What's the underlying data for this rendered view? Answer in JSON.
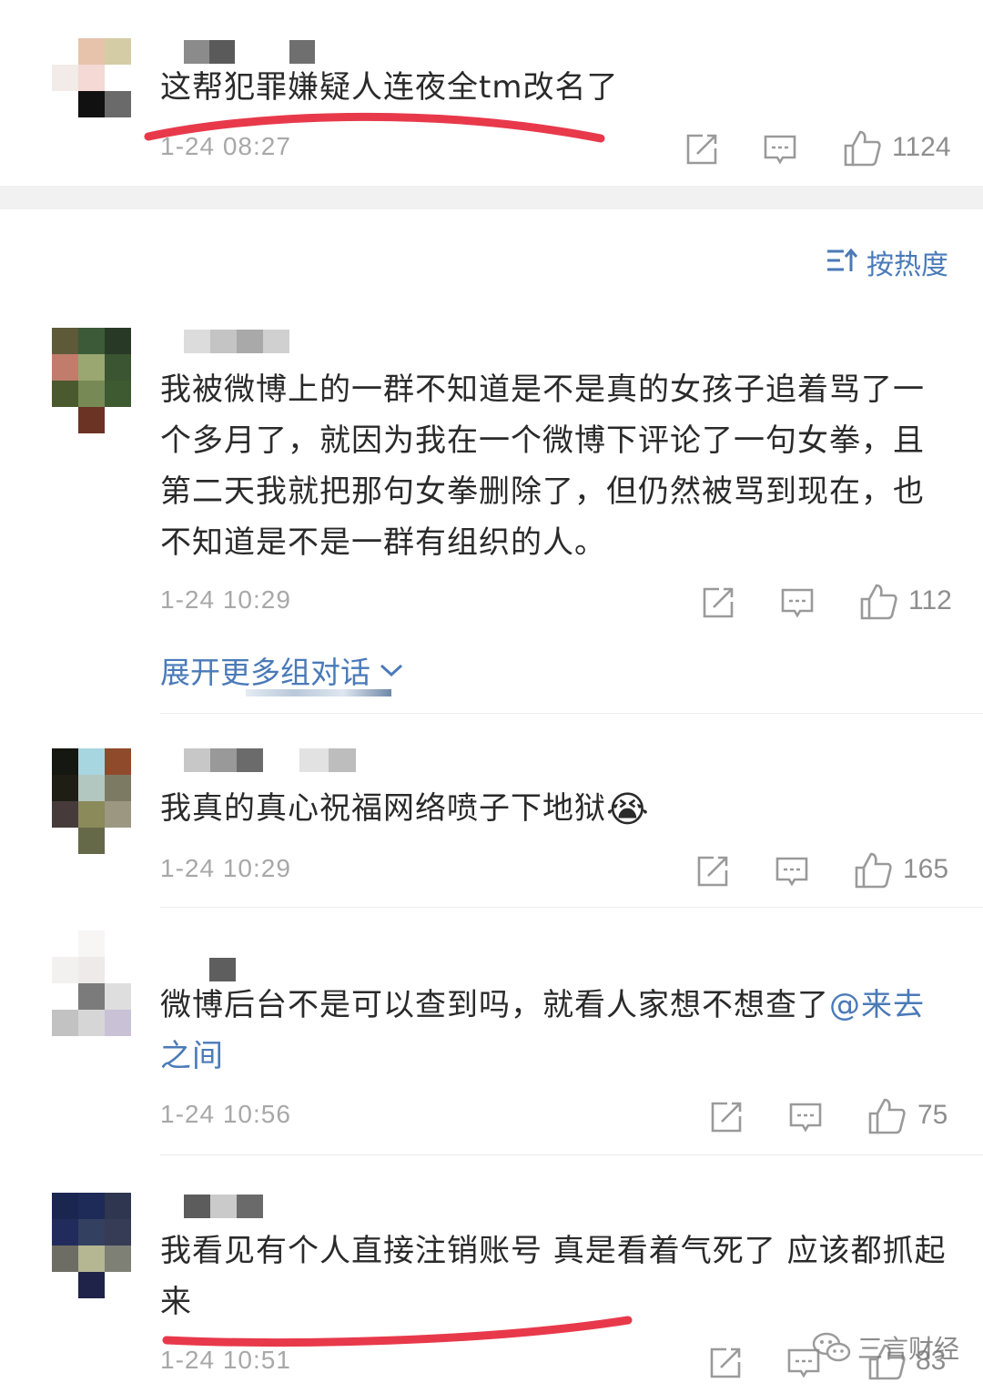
{
  "sort": {
    "label": "按热度"
  },
  "comments": [
    {
      "text": "这帮犯罪嫌疑人连夜全tm改名了",
      "time": "1-24 08:27",
      "likes": "1124"
    },
    {
      "text": "我被微博上的一群不知道是不是真的女孩子追着骂了一个多月了，就因为我在一个微博下评论了一句女拳，且第二天我就把那句女拳删除了，但仍然被骂到现在，也不知道是不是一群有组织的人。",
      "time": "1-24 10:29",
      "likes": "112",
      "expand": "展开更多组对话"
    },
    {
      "text": "我真的真心祝福网络喷子下地狱",
      "emoji": "😭",
      "time": "1-24 10:29",
      "likes": "165"
    },
    {
      "text": "微博后台不是可以查到吗，就看人家想不想查了",
      "mention": "@来去之间",
      "time": "1-24 10:56",
      "likes": "75"
    },
    {
      "text": "我看见有个人直接注销账号 真是看着气死了 应该都抓起来",
      "time": "1-24 10:51",
      "likes": "83"
    }
  ],
  "watermark": "三言财经",
  "colors": {
    "link": "#4a7ab8",
    "underline": "#e8394b",
    "meta": "#a8a8a8"
  },
  "icons": [
    "share-icon",
    "comment-icon",
    "thumbs-up-icon",
    "sort-icon",
    "chevron-down-icon",
    "wechat-icon"
  ]
}
